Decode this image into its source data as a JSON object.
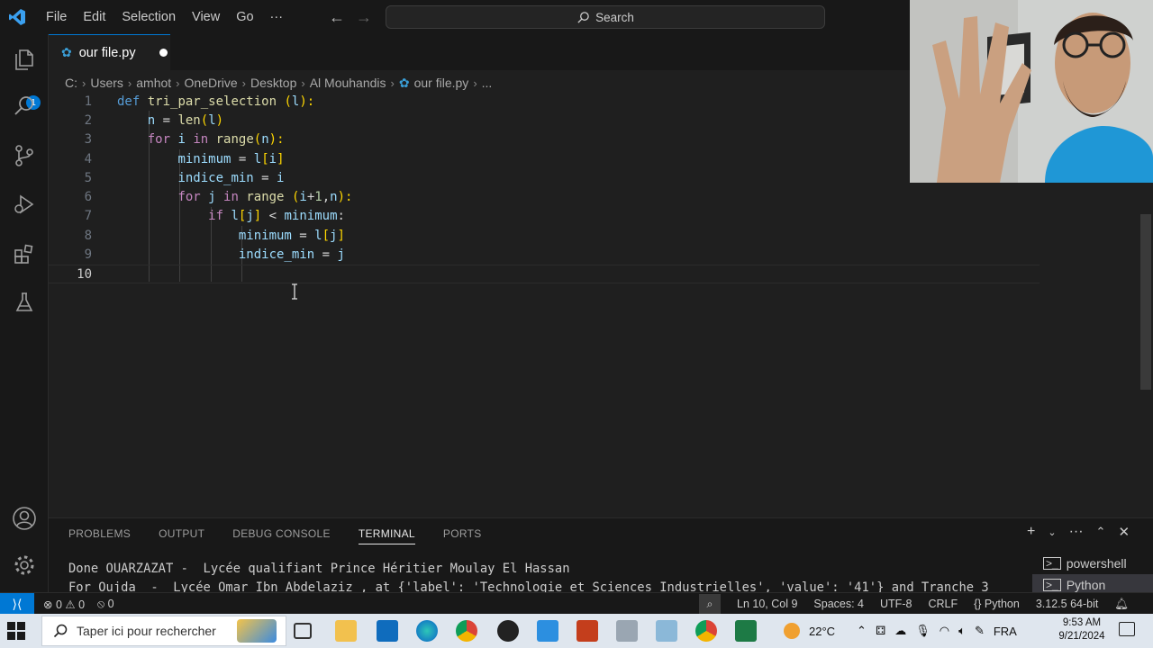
{
  "menu": [
    "File",
    "Edit",
    "Selection",
    "View",
    "Go",
    "···"
  ],
  "search": {
    "label": "Search"
  },
  "explorer_badge": "1",
  "tab": {
    "title": "our file.py"
  },
  "breadcrumb": [
    "C:",
    "Users",
    "amhot",
    "OneDrive",
    "Desktop",
    "Al Mouhandis",
    "our file.py",
    "..."
  ],
  "line_numbers": [
    "1",
    "2",
    "3",
    "4",
    "5",
    "6",
    "7",
    "8",
    "9",
    "10"
  ],
  "code": {
    "l1": {
      "kw": "def",
      "fn": "tri_par_selection",
      "open": "(",
      "param": "l",
      "close": "):"
    },
    "l2": {
      "var": "n",
      "eq": " = ",
      "fn": "len",
      "open": "(",
      "arg": "l",
      "close": ")"
    },
    "l3": {
      "kw": "for",
      "var": "i",
      "in": "in",
      "fn": "range",
      "open": "(",
      "arg": "n",
      "close": "):"
    },
    "l4": {
      "var": "minimum",
      "eq": " = ",
      "arr": "l",
      "open": "[",
      "idx": "i",
      "close": "]"
    },
    "l5": {
      "var": "indice_min",
      "eq": " = ",
      "val": "i"
    },
    "l6": {
      "kw": "for",
      "var": "j",
      "in": "in",
      "fn": "range",
      "open": "(",
      "a1": "i",
      "plus": "+",
      "num": "1",
      "comma": ",",
      "a2": "n",
      "close": "):"
    },
    "l7": {
      "kw": "if",
      "arr": "l",
      "open": "[",
      "idx": "j",
      "close": "]",
      "op": " < ",
      "var": "minimum",
      "colon": ":"
    },
    "l8": {
      "var": "minimum",
      "eq": " = ",
      "arr": "l",
      "open": "[",
      "idx": "j",
      "close": "]"
    },
    "l9": {
      "var": "indice_min",
      "eq": " = ",
      "val": "j"
    }
  },
  "panel": {
    "tabs": [
      "PROBLEMS",
      "OUTPUT",
      "DEBUG CONSOLE",
      "TERMINAL",
      "PORTS"
    ],
    "active_tab": "TERMINAL",
    "terminal_lines": [
      "Done OUARZAZAT -  Lycée qualifiant Prince Héritier Moulay El Hassan",
      "For Oujda  -  Lycée Omar Ibn Abdelaziz , at {'label': 'Technologie et Sciences Industrielles', 'value': '41'} and Tranche 3"
    ],
    "terminals": [
      "powershell",
      "Python"
    ]
  },
  "status": {
    "errors": "0",
    "warnings": "0",
    "ports": "0",
    "position": "Ln 10, Col 9",
    "spaces": "Spaces: 4",
    "encoding": "UTF-8",
    "eol": "CRLF",
    "language": "Python",
    "interpreter": "3.12.5 64-bit"
  },
  "taskbar": {
    "search_placeholder": "Taper ici pour rechercher",
    "weather": "22°C",
    "lang": "FRA",
    "time": "9:53 AM",
    "date": "9/21/2024"
  },
  "colors": {
    "accent": "#0078d4",
    "editor_bg": "#1f1f1f",
    "chrome_bg": "#181818"
  }
}
